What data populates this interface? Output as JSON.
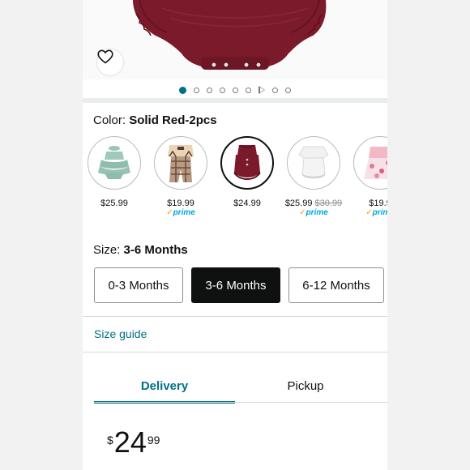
{
  "colors": {
    "accent": "#007185",
    "text": "#0f1111",
    "product_red": "#7a1a2b",
    "prime_blue": "#00a8e1",
    "prime_check": "#ff9900"
  },
  "hero": {
    "image_icon": "baby-romper-image",
    "wishlist_icon": "heart-icon"
  },
  "carousel": {
    "dots": [
      "image",
      "image",
      "image",
      "image",
      "image",
      "image",
      "video",
      "image",
      "image"
    ],
    "active_index": 0
  },
  "color_selector": {
    "label": "Color:",
    "selected_value": "Solid Red-2pcs",
    "options": [
      {
        "price": "$25.99",
        "list_price": "",
        "prime": false,
        "selected": false
      },
      {
        "price": "$19.99",
        "list_price": "",
        "prime": true,
        "selected": false
      },
      {
        "price": "$24.99",
        "list_price": "",
        "prime": false,
        "selected": true
      },
      {
        "price": "$25.99",
        "list_price": "$30.99",
        "prime": true,
        "selected": false
      },
      {
        "price": "$19.9",
        "list_price": "",
        "prime": true,
        "selected": false
      }
    ],
    "prime_label": "prime"
  },
  "size_selector": {
    "label": "Size:",
    "selected_value": "3-6 Months",
    "options": [
      "0-3 Months",
      "3-6 Months",
      "6-12 Months"
    ],
    "selected_index": 1
  },
  "size_guide": "Size guide",
  "tabs": [
    {
      "label": "Delivery",
      "active": true
    },
    {
      "label": "Pickup",
      "active": false
    }
  ],
  "price": {
    "symbol": "$",
    "whole": "24",
    "fraction": "99"
  }
}
